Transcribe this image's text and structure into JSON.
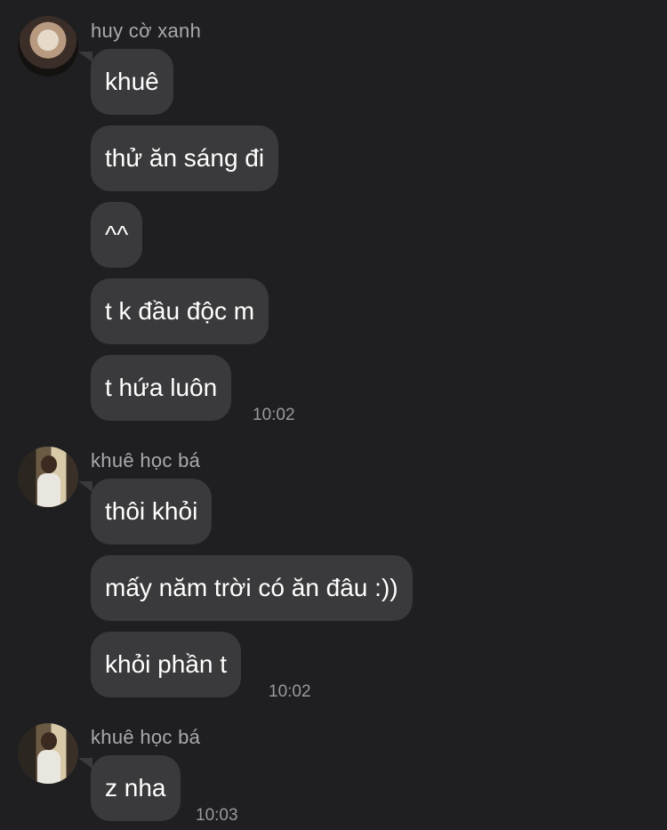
{
  "groups": [
    {
      "sender": "huy cờ xanh",
      "avatar": "user-avatar-huy",
      "messages": [
        "khuê",
        "thử ăn sáng đi",
        "^^",
        "t k đầu độc m",
        "t hứa luôn"
      ],
      "time": "10:02"
    },
    {
      "sender": "khuê học bá",
      "avatar": "user-avatar-khue",
      "messages": [
        "thôi khỏi",
        "mấy năm trời có ăn đâu :))",
        "khỏi phần t"
      ],
      "time": "10:02"
    },
    {
      "sender": "khuê học bá",
      "avatar": "user-avatar-khue",
      "messages": [
        "z nha"
      ],
      "time": "10:03"
    }
  ]
}
